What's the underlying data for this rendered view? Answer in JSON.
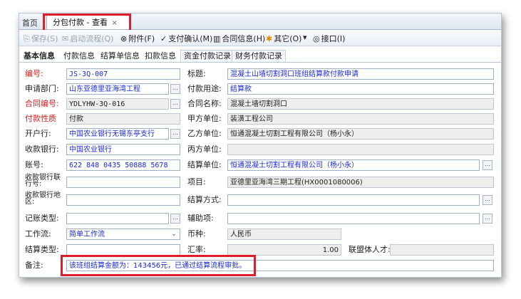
{
  "tabs": {
    "home": "首页",
    "active": "分包付款 - 查看",
    "close": "×"
  },
  "toolbar": {
    "items": [
      {
        "icon": "⎘",
        "label": "保存(S)"
      },
      {
        "icon": "✉",
        "label": "启动流程(Q)"
      },
      {
        "icon": "⊗",
        "label": "附件(F)"
      },
      {
        "icon": "✓",
        "label": "支付确认(M)"
      },
      {
        "icon": "▥",
        "label": "合同信息(H)"
      },
      {
        "icon": "✱",
        "label": "其它(O)"
      },
      {
        "icon": "▾",
        "label": ""
      },
      {
        "icon": "◎",
        "label": "接口(I)"
      }
    ]
  },
  "subtabs": [
    "基本信息",
    "付款信息",
    "结算单信息",
    "扣款信息",
    "资金付款记录",
    "财务付款记录"
  ],
  "form": {
    "bianhao_label": "编号:",
    "bianhao": "JS-3Q-007",
    "biaoti_label": "标题:",
    "biaoti": "混凝土山墙切割洞口班组结算款付款申请",
    "sqbm_label": "申请部门:",
    "sqbm": "山东亚德里亚海湾工程",
    "fkyt_label": "付款用途:",
    "fkyt": "结算款",
    "htbh_label": "合同编号:",
    "htbh": "YDLYHW-3Q-016",
    "htmc_label": "合同名称:",
    "htmc": "混凝土墙切割洞口",
    "fkxz_label": "付款性质",
    "fkxz": "付款",
    "jfdw_label": "甲方单位:",
    "jfdw": "装潢工程公司",
    "khh_label": "开户行:",
    "khh": "中国农业银行无锡东亭支行",
    "yfdw_label": "乙方单位:",
    "yfdw": "恒通混凝土切割工程有限公司（杨小永）",
    "skyh_label": "收款银行:",
    "skyh": "中国农业银行",
    "bfdw_label": "丙方单位:",
    "bfdw": "",
    "zh_label": "账号:",
    "zh": "622 848 0435 50888 5678",
    "jsdw_label": "结算单位:",
    "jsdw": "恒通混凝土切割工程有限公司（杨小永）",
    "skyhlh_label": "收款银行联行号:",
    "skyhlh": "",
    "xm_label": "项目:",
    "xm": "亚德里亚海湾三期工程(HX0001080006)",
    "skyhdq_label": "收款银行地区:",
    "skyhdq": "",
    "jsfs_label": "结算方式:",
    "jsfs": "",
    "jzlx_label": "记账类型:",
    "jzlx": "",
    "fzx_label": "辅助项:",
    "fzx": "",
    "gzl_label": "工作流:",
    "gzl": "简单工作流",
    "bz_label": "币种:",
    "bz": "人民币",
    "jslx_label": "结算类型:",
    "jslx": "",
    "hl_label": "汇率:",
    "hl": "1.00",
    "lmtrc_label": "联盟体人才:",
    "lmtrc": "",
    "beizhu_label": "备注:",
    "beizhu": "该班组结算金额为：143456元，已通过结算流程审批。"
  },
  "colors": {
    "label_red": "#d02020",
    "value_blue": "#1a2ad0",
    "highlight": "#e01e2a"
  }
}
